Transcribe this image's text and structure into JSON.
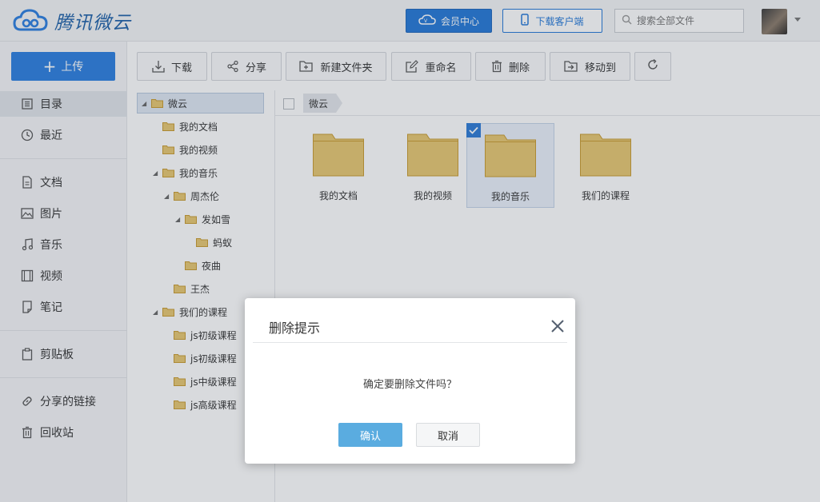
{
  "header": {
    "logo_text": "腾讯微云",
    "vip_label": "会员中心",
    "download_client_label": "下载客户端",
    "search_placeholder": "搜索全部文件"
  },
  "sidebar": {
    "upload_label": "上传",
    "items": [
      {
        "label": "目录",
        "icon": "catalog-icon"
      },
      {
        "label": "最近",
        "icon": "clock-icon"
      },
      {
        "label": "文档",
        "icon": "document-icon"
      },
      {
        "label": "图片",
        "icon": "image-icon"
      },
      {
        "label": "音乐",
        "icon": "music-icon"
      },
      {
        "label": "视频",
        "icon": "video-icon"
      },
      {
        "label": "笔记",
        "icon": "note-icon"
      },
      {
        "label": "剪贴板",
        "icon": "clipboard-icon"
      },
      {
        "label": "分享的链接",
        "icon": "link-icon"
      },
      {
        "label": "回收站",
        "icon": "trash-icon"
      }
    ]
  },
  "toolbar": {
    "download": "下载",
    "share": "分享",
    "new_folder": "新建文件夹",
    "rename": "重命名",
    "delete": "删除",
    "move_to": "移动到"
  },
  "tree": [
    {
      "label": "微云"
    },
    {
      "label": "我的文档"
    },
    {
      "label": "我的视频"
    },
    {
      "label": "我的音乐"
    },
    {
      "label": "周杰伦"
    },
    {
      "label": "发如雪"
    },
    {
      "label": "蚂蚁"
    },
    {
      "label": "夜曲"
    },
    {
      "label": "王杰"
    },
    {
      "label": "我们的课程"
    },
    {
      "label": "js初级课程"
    },
    {
      "label": "js初级课程"
    },
    {
      "label": "js中级课程"
    },
    {
      "label": "js高级课程"
    }
  ],
  "breadcrumb": {
    "current": "微云"
  },
  "files": [
    {
      "name": "我的文档",
      "selected": false
    },
    {
      "name": "我的视频",
      "selected": false
    },
    {
      "name": "我的音乐",
      "selected": true
    },
    {
      "name": "我们的课程",
      "selected": false
    }
  ],
  "dialog": {
    "title": "删除提示",
    "message": "确定要删除文件吗？",
    "confirm": "确认",
    "cancel": "取消"
  },
  "colors": {
    "accent": "#2a7ee0",
    "folder": "#e8c770",
    "folder_edge": "#c99a2e"
  }
}
